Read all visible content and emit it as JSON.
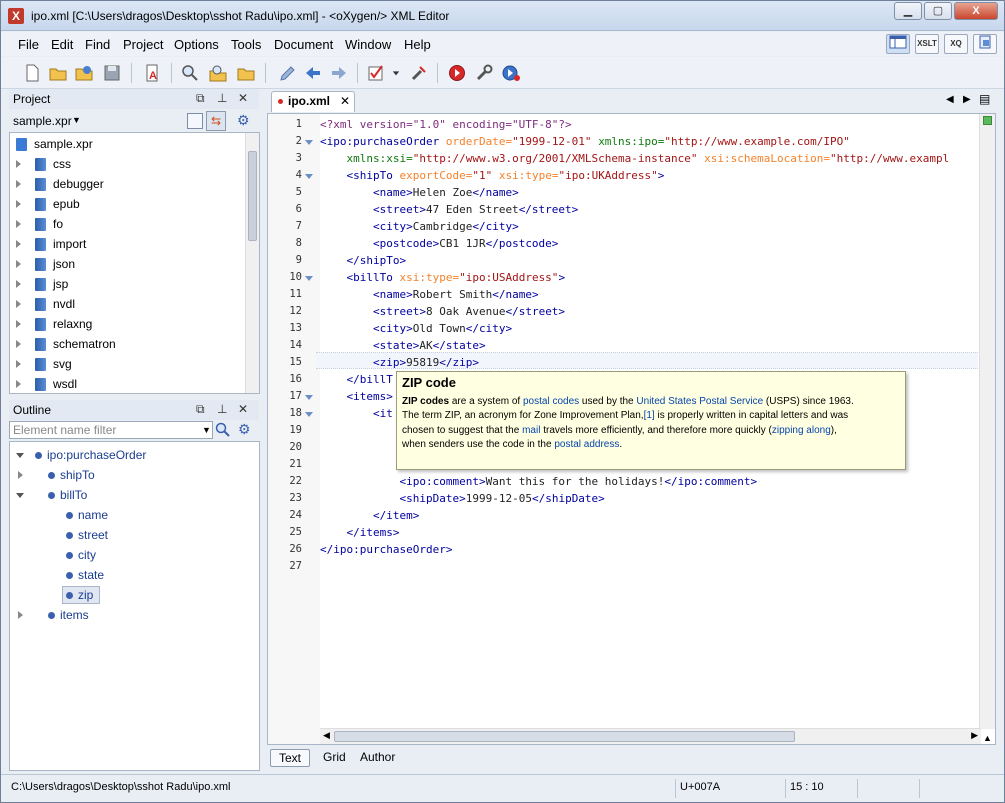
{
  "window": {
    "title": "ipo.xml [C:\\Users\\dragos\\Desktop\\sshot Radu\\ipo.xml] - <oXygen/> XML Editor",
    "min": "▁",
    "max": "▢",
    "close": "X"
  },
  "menu": [
    {
      "label": "File"
    },
    {
      "label": "Edit"
    },
    {
      "label": "Find"
    },
    {
      "label": "Project"
    },
    {
      "label": "Options"
    },
    {
      "label": "Tools"
    },
    {
      "label": "Document"
    },
    {
      "label": "Window"
    },
    {
      "label": "Help"
    }
  ],
  "perspectives": {
    "xslt": "XSLT",
    "xq": "XQ"
  },
  "project": {
    "header": "Project",
    "file": "sample.xpr",
    "root": "sample.xpr",
    "folders": [
      "css",
      "debugger",
      "epub",
      "fo",
      "import",
      "json",
      "jsp",
      "nvdl",
      "relaxng",
      "schematron",
      "svg",
      "wsdl"
    ]
  },
  "outline": {
    "header": "Outline",
    "filter_placeholder": "Element name filter",
    "nodes": [
      {
        "label": "ipo:purchaseOrder"
      },
      {
        "label": "shipTo"
      },
      {
        "label": "billTo"
      },
      {
        "label": "name"
      },
      {
        "label": "street"
      },
      {
        "label": "city"
      },
      {
        "label": "state"
      },
      {
        "label": "zip"
      },
      {
        "label": "items"
      }
    ]
  },
  "editor": {
    "tab": "ipo.xml",
    "modes": [
      "Text",
      "Grid",
      "Author"
    ]
  },
  "tooltip": {
    "title": "ZIP code",
    "line1_b": "ZIP codes",
    "line1_a": " are a system of ",
    "line1_l1": "postal codes",
    "line1_c": " used by the ",
    "line1_l2": "United States Postal Service",
    "line1_d": " (USPS) since 1963.",
    "line2_a": "The term ZIP, an acronym for Zone Improvement Plan,",
    "line2_l": "[1]",
    "line2_b": " is properly written in capital letters and was",
    "line3_a": "chosen to suggest that the ",
    "line3_l1": "mail",
    "line3_b": " travels more efficiently, and therefore more quickly (",
    "line3_l2": "zipping along",
    "line3_c": "),",
    "line4_a": "when senders use the code in the ",
    "line4_l": "postal address",
    "line4_b": "."
  },
  "status": {
    "path": "C:\\Users\\dragos\\Desktop\\sshot Radu\\ipo.xml",
    "unicode": "U+007A",
    "position": "15 : 10"
  }
}
